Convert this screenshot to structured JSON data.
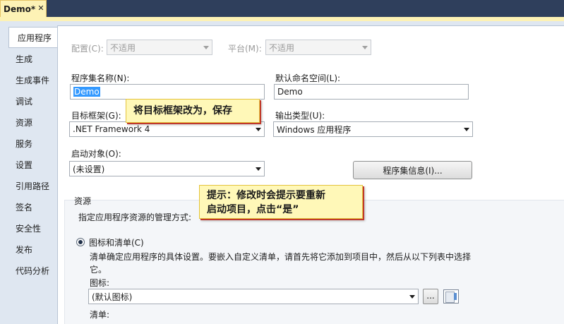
{
  "document_tab": {
    "title": "Demo*",
    "close_glyph": "✕"
  },
  "sidebar": {
    "items": [
      {
        "label": "应用程序",
        "active": true
      },
      {
        "label": "生成"
      },
      {
        "label": "生成事件"
      },
      {
        "label": "调试"
      },
      {
        "label": "资源"
      },
      {
        "label": "服务"
      },
      {
        "label": "设置"
      },
      {
        "label": "引用路径"
      },
      {
        "label": "签名"
      },
      {
        "label": "安全性"
      },
      {
        "label": "发布"
      },
      {
        "label": "代码分析"
      }
    ]
  },
  "config": {
    "label": "配置(C):",
    "value": "不适用"
  },
  "platform": {
    "label": "平台(M):",
    "value": "不适用"
  },
  "assembly_name": {
    "label": "程序集名称(N):",
    "value": "Demo"
  },
  "default_namespace": {
    "label": "默认命名空间(L):",
    "value": "Demo"
  },
  "target_framework": {
    "label": "目标框架(G):",
    "value": ".NET Framework 4"
  },
  "output_type": {
    "label": "输出类型(U):",
    "value": "Windows 应用程序"
  },
  "startup_object": {
    "label": "启动对象(O):",
    "value": "(未设置)"
  },
  "assembly_info_button": "程序集信息(I)...",
  "resources": {
    "title": "资源",
    "description": "指定应用程序资源的管理方式:",
    "icon_manifest_option": "图标和清单(C)",
    "option_help_line1": "清单确定应用程序的具体设置。要嵌入自定义清单，请首先将它添加到项目中，然后从以下列表中选择",
    "option_help_line2": "它。",
    "icon_label": "图标:",
    "icon_value": "(默认图标)",
    "browse_button": "...",
    "manifest_label": "清单:"
  },
  "annotations": {
    "note1": "将目标框架改为，保存",
    "note2_line1": "提示：修改时会提示要重新",
    "note2_line2": "启动项目，点击“是”"
  },
  "colors": {
    "selection": "#3399ff",
    "note_background": "#fff8b8",
    "frame_background": "#dfe7f1",
    "tab_active": "#fdf2b5"
  }
}
